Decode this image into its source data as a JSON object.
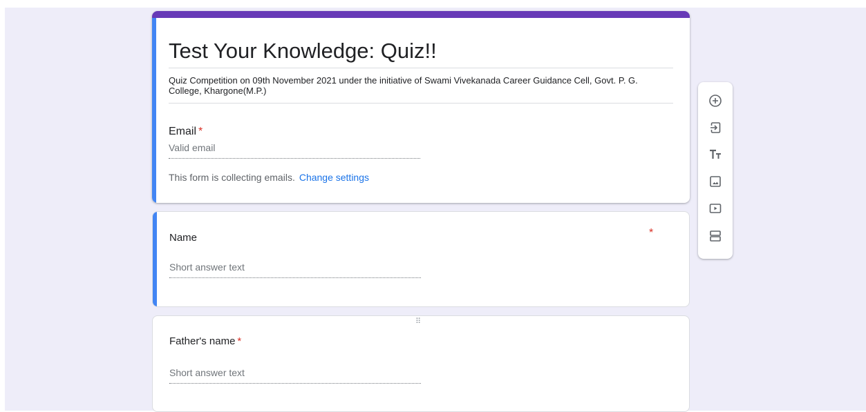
{
  "form": {
    "title": "Test Your Knowledge: Quiz!!",
    "description": "Quiz Competition on 09th November 2021 under the initiative of Swami Vivekanada Career Guidance Cell, Govt. P. G. College, Khargone(M.P.)",
    "accent_color": "#673ab7",
    "focus_color": "#4285f4"
  },
  "email_question": {
    "label": "Email",
    "required_mark": "*",
    "placeholder": "Valid email",
    "note": "This form is collecting emails.",
    "settings_link": "Change settings"
  },
  "questions": [
    {
      "label": "Name",
      "required_mark": "*",
      "placeholder": "Short answer text"
    },
    {
      "label": "Father's name",
      "required_mark": "*",
      "placeholder": "Short answer text"
    }
  ],
  "drag_handle": "⠿",
  "toolbar": {
    "items": [
      {
        "icon": "add-question-icon"
      },
      {
        "icon": "import-questions-icon"
      },
      {
        "icon": "add-title-description-icon"
      },
      {
        "icon": "add-image-icon"
      },
      {
        "icon": "add-video-icon"
      },
      {
        "icon": "add-section-icon"
      }
    ]
  }
}
